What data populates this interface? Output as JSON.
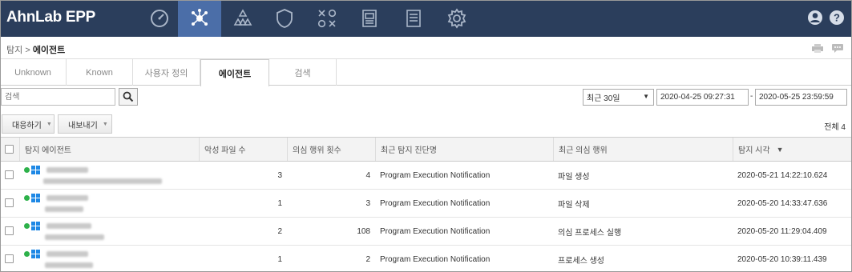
{
  "app": {
    "title": "AhnLab EPP"
  },
  "nav": {
    "items": [
      {
        "name": "dashboard",
        "icon": "speedometer-icon",
        "active": false
      },
      {
        "name": "detection",
        "icon": "network-nodes-icon",
        "active": true
      },
      {
        "name": "groups",
        "icon": "hierarchy-icon",
        "active": false
      },
      {
        "name": "policy",
        "icon": "shield-icon",
        "active": false
      },
      {
        "name": "response",
        "icon": "ox-grid-icon",
        "active": false
      },
      {
        "name": "reports",
        "icon": "report-icon",
        "active": false
      },
      {
        "name": "documents",
        "icon": "document-icon",
        "active": false
      },
      {
        "name": "settings",
        "icon": "gear-icon",
        "active": false
      }
    ],
    "right_icons": [
      "user-icon",
      "help-icon"
    ]
  },
  "breadcrumb": {
    "root": "탐지",
    "separator": ">",
    "current": "에이전트"
  },
  "breadcrumb_icons": [
    "print-icon",
    "comment-icon"
  ],
  "tabs": [
    {
      "label": "Unknown",
      "active": false
    },
    {
      "label": "Known",
      "active": false
    },
    {
      "label": "사용자 정의",
      "active": false
    },
    {
      "label": "에이전트",
      "active": true
    },
    {
      "label": "검색",
      "active": false
    }
  ],
  "search": {
    "placeholder": "검색",
    "button_icon": "search-icon"
  },
  "period": {
    "selected": "최근 30일",
    "start": "2020-04-25 09:27:31",
    "separator": "-",
    "end": "2020-05-25 23:59:59"
  },
  "actions": {
    "respond_label": "대응하기",
    "export_label": "내보내기",
    "total_label": "전체 4"
  },
  "table": {
    "columns": [
      "탐지 에이전트",
      "악성 파일 수",
      "의심 행위 횟수",
      "최근 탐지 진단명",
      "최근 의심 행위",
      "탐지 시각"
    ],
    "sort_indicator": "▼",
    "rows": [
      {
        "malicious_files": "3",
        "suspicious_count": "4",
        "detection_name": "Program Execution Notification",
        "suspicious_action": "파일 생성",
        "detected_at": "2020-05-21 14:22:10.624"
      },
      {
        "malicious_files": "1",
        "suspicious_count": "3",
        "detection_name": "Program Execution Notification",
        "suspicious_action": "파일 삭제",
        "detected_at": "2020-05-20 14:33:47.636"
      },
      {
        "malicious_files": "2",
        "suspicious_count": "108",
        "detection_name": "Program Execution Notification",
        "suspicious_action": "의심 프로세스 실행",
        "detected_at": "2020-05-20 11:29:04.409"
      },
      {
        "malicious_files": "1",
        "suspicious_count": "2",
        "detection_name": "Program Execution Notification",
        "suspicious_action": "프로세스 생성",
        "detected_at": "2020-05-20 10:39:11.439"
      }
    ]
  },
  "colors": {
    "topbar": "#2b3e5c",
    "active_nav": "#4b6ea8",
    "online": "#2db14a",
    "windows": "#1e88e5"
  }
}
